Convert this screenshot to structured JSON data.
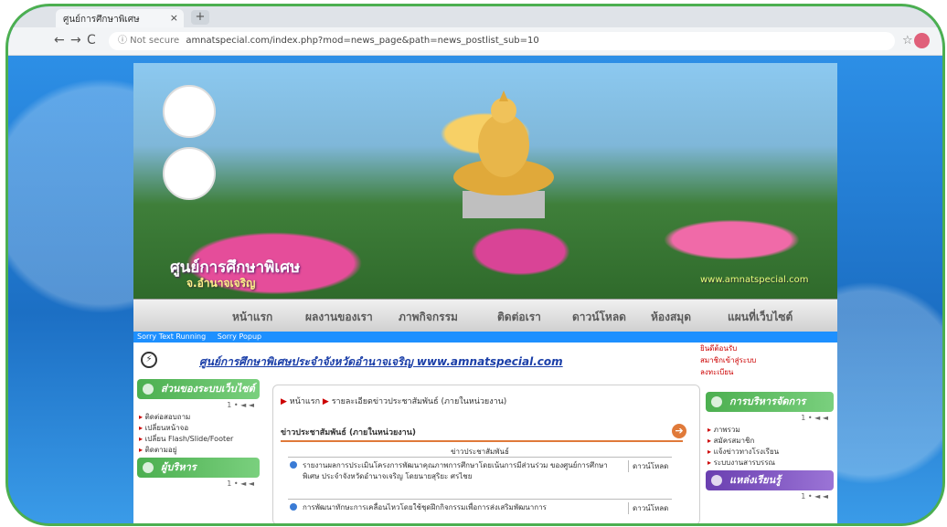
{
  "browser": {
    "tab_title": "ศูนย์การศึกษาพิเศษ",
    "tab_close": "×",
    "new_tab": "+",
    "window_label": "",
    "nav": {
      "back": "←",
      "forward": "→",
      "reload": "C"
    },
    "url_info": "ⓘ Not secure",
    "url": "amnatspecial.com/index.php?mod=news_page&path=news_postlist_sub=10",
    "star": "☆"
  },
  "site": {
    "title": "ศูนย์การศึกษาพิเศษ",
    "subtitle": "จ.อำนาจเจริญ",
    "banner_url": "www.amnatspecial.com",
    "menu": [
      "หน้าแรก",
      "ผลงานของเรา",
      "ภาพกิจกรรม",
      "ติดต่อเรา",
      "ดาวน์โหลด",
      "ห้องสมุด",
      "แผนที่เว็บไซต์"
    ],
    "runbar": [
      "Sorry Text Running",
      "Sorry Popup"
    ],
    "marquee": "ศูนย์การศึกษาพิเศษประจำจังหวัดอำนาจเจริญ  www.amnatspecial.com",
    "topright": [
      "ยินดีต้อนรับ",
      "สมาชิกเข้าสู่ระบบ",
      "ลงทะเบียน"
    ],
    "left": {
      "section1": "ส่วนของระบบเว็บไซต์",
      "pager1": "1 • ◄ ◄",
      "links1": [
        "ติดต่อสอบถาม",
        "เปลี่ยนหน้าจอ",
        "เปลี่ยน Flash/Slide/Footer",
        "ติดตามอยู่"
      ],
      "section2": "ผู้บริหาร",
      "pager2": "1 • ◄ ◄"
    },
    "right": {
      "section1": "การบริหารจัดการ",
      "pager1": "1 • ◄ ◄",
      "links1": [
        "ภาพรวม",
        "สมัครสมาชิก",
        "แจ้งข่าวทางโรงเรียน",
        "ระบบงานสารบรรณ"
      ],
      "section2": "แหล่งเรียนรู้",
      "pager2": "1 • ◄ ◄"
    },
    "main": {
      "crumb_home": "หน้าแรก",
      "crumb_page": "รายละเอียดข่าวประชาสัมพันธ์ (ภายในหน่วยงาน)",
      "news_header": "ข่าวประชาสัมพันธ์ (ภายในหน่วยงาน)",
      "news_arrow": "➔",
      "table_header": "ข่าวประชาสัมพันธ์",
      "rows": [
        {
          "text": "รายงานผลการประเมินโครงการพัฒนาคุณภาพการศึกษาโดยเน้นการมีส่วนร่วม ของศูนย์การศึกษาพิเศษ ประจำจังหวัดอำนาจเจริญ โดยนายสุริยะ ศรไชย",
          "dl": "ดาวน์โหลด"
        },
        {
          "text": "การพัฒนาทักษะการเคลื่อนไหวโดยใช้ชุดฝึกกิจกรรมเพื่อการส่งเสริมพัฒนาการ",
          "dl": "ดาวน์โหลด"
        }
      ]
    }
  },
  "colors": {
    "frame": "#4caf50",
    "bg": "#1f7fd6",
    "link": "#1a3ea8",
    "accent": "#e07a3a"
  }
}
